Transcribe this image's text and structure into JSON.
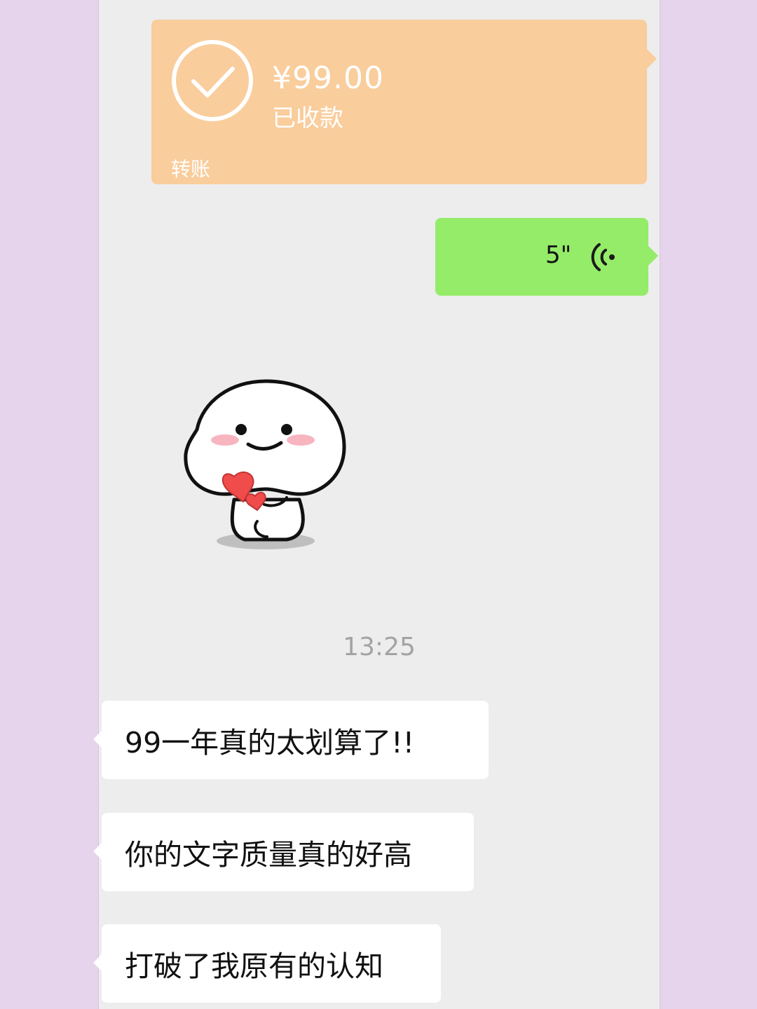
{
  "transfer": {
    "amount": "¥99.00",
    "status": "已收款",
    "label": "转账"
  },
  "voice": {
    "duration": "5\"",
    "icon": "voice-wave-icon"
  },
  "sticker": {
    "icon": "smiling-character-holding-hearts-sticker"
  },
  "timestamp": "13:25",
  "messages": [
    {
      "text": "99一年真的太划算了!!"
    },
    {
      "text": "你的文字质量真的好高"
    },
    {
      "text": "打破了我原有的认知"
    }
  ],
  "colors": {
    "transfer_bubble": "#f9cd9c",
    "voice_bubble": "#95ec69",
    "received_bubble": "#ffffff",
    "chat_background": "#ededed",
    "outer_background": "#e6d3ec"
  }
}
